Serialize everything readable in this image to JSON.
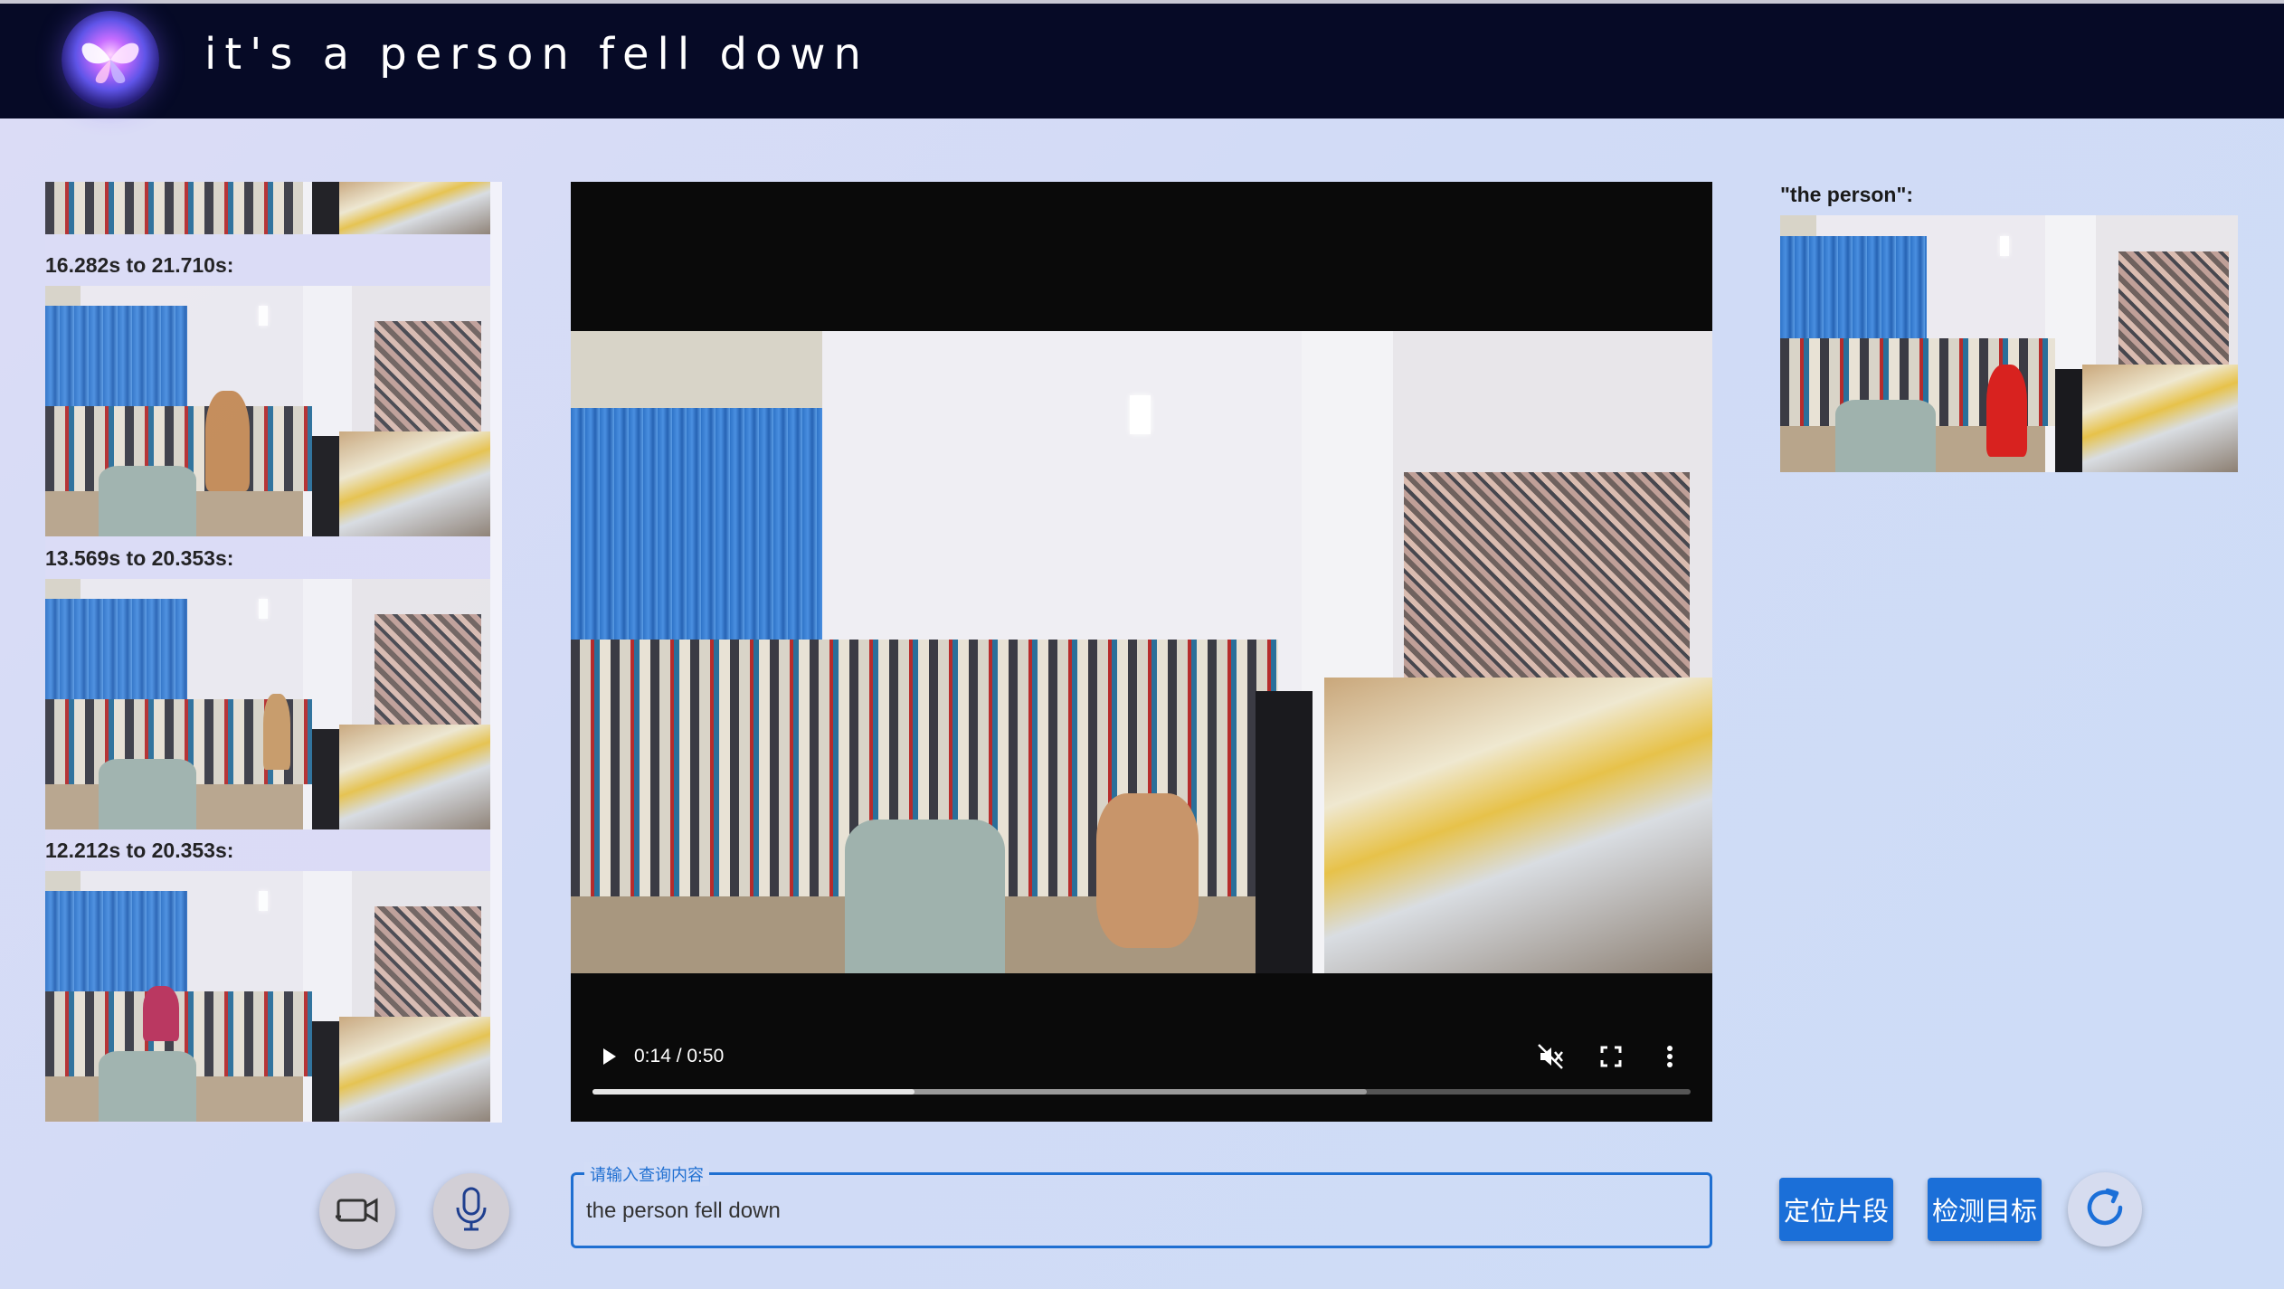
{
  "header": {
    "title": "it's a person fell down",
    "logo_icon": "butterfly-logo-icon"
  },
  "results": {
    "items": [
      {
        "label": ""
      },
      {
        "label": "16.282s to 21.710s:"
      },
      {
        "label": "13.569s to 20.353s:"
      },
      {
        "label": "12.212s to 20.353s:"
      }
    ]
  },
  "video": {
    "time_display": "0:14 / 0:50",
    "progress": 0.293,
    "buffered": 0.705,
    "muted": true,
    "controls": [
      "play-icon",
      "mute-icon",
      "fullscreen-icon",
      "more-vert-icon"
    ]
  },
  "target": {
    "label": "\"the person\":"
  },
  "query": {
    "legend": "请输入查询内容",
    "value": "the person fell down"
  },
  "buttons": {
    "locate_segment": "定位片段",
    "detect_target": "检测目标",
    "camera_icon": "video-camera-icon",
    "mic_icon": "microphone-icon",
    "refresh_icon": "refresh-icon"
  },
  "colors": {
    "header_bg": "#060a26",
    "accent": "#1b6fd8",
    "page_bg": "#d3dcf6"
  }
}
